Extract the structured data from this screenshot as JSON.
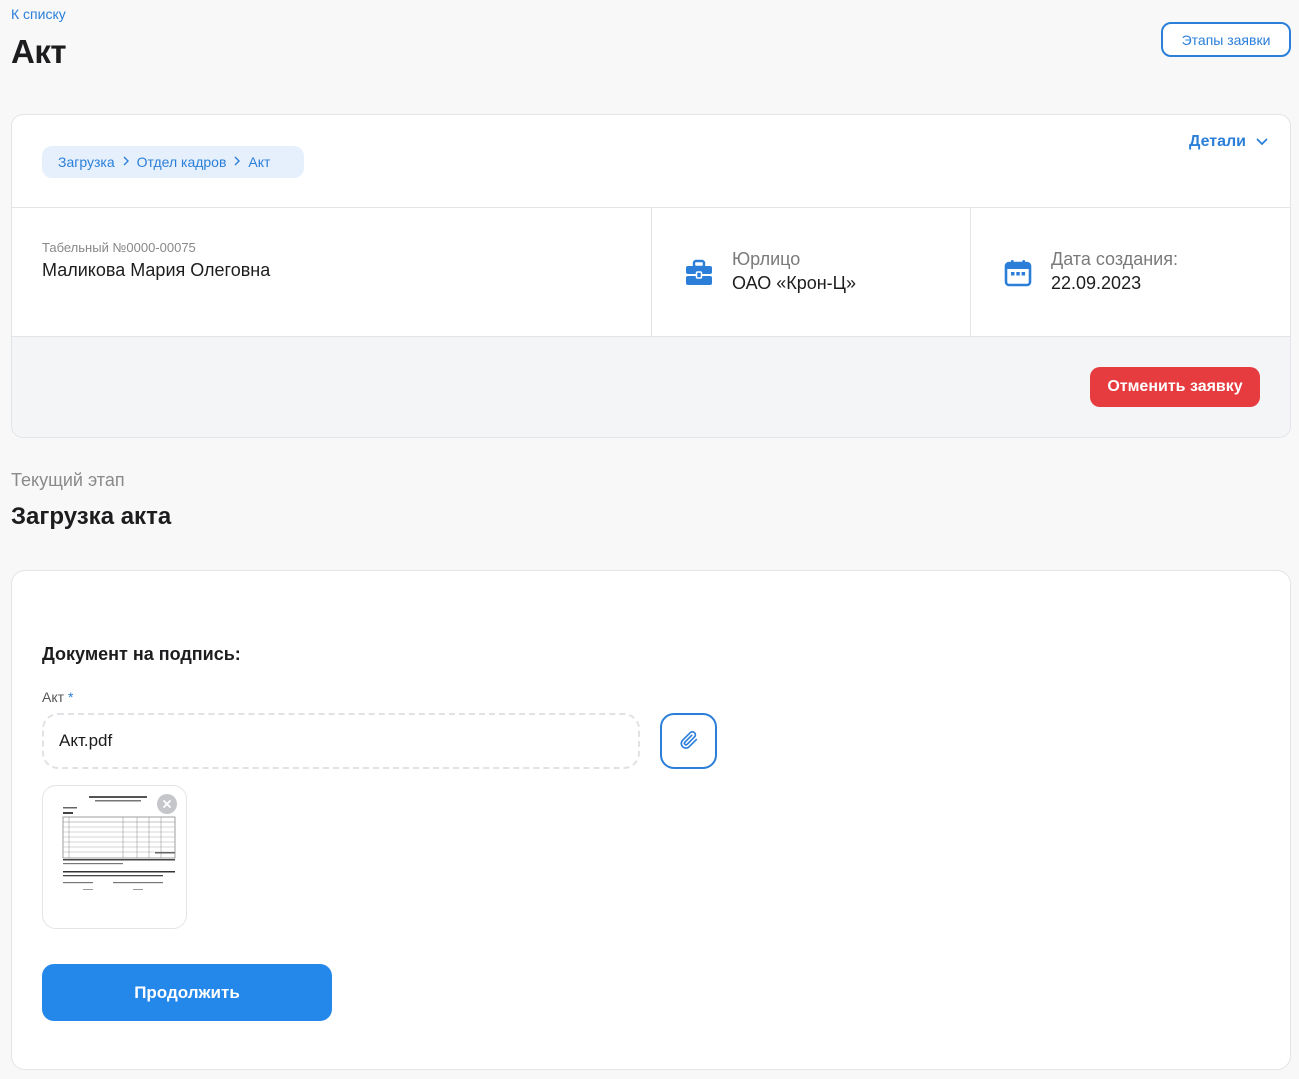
{
  "header": {
    "back_link": "К списку",
    "title": "Акт",
    "stages_button": "Этапы заявки"
  },
  "info_card": {
    "breadcrumb": [
      "Загрузка",
      "Отдел кадров",
      "Акт"
    ],
    "details_toggle": "Детали",
    "employee": {
      "tab_number": "Табельный №0000-00075",
      "name": "Маликова Мария Олеговна"
    },
    "legal_entity": {
      "icon": "briefcase-icon",
      "label": "Юрлицо",
      "value": "ОАО «Крон-Ц»"
    },
    "created": {
      "icon": "calendar-icon",
      "label": "Дата создания:",
      "value": "22.09.2023"
    },
    "cancel_button": "Отменить заявку"
  },
  "stage": {
    "caption": "Текущий этап",
    "title": "Загрузка акта"
  },
  "upload": {
    "heading": "Документ на подпись:",
    "field_label": "Акт",
    "required_mark": "*",
    "file_name": "Акт.pdf",
    "continue_button": "Продолжить"
  },
  "colors": {
    "accent": "#2b7fd9",
    "primary_button": "#2487ea",
    "danger": "#e63b3f",
    "breadcrumb_bg": "#e6f0fc"
  }
}
